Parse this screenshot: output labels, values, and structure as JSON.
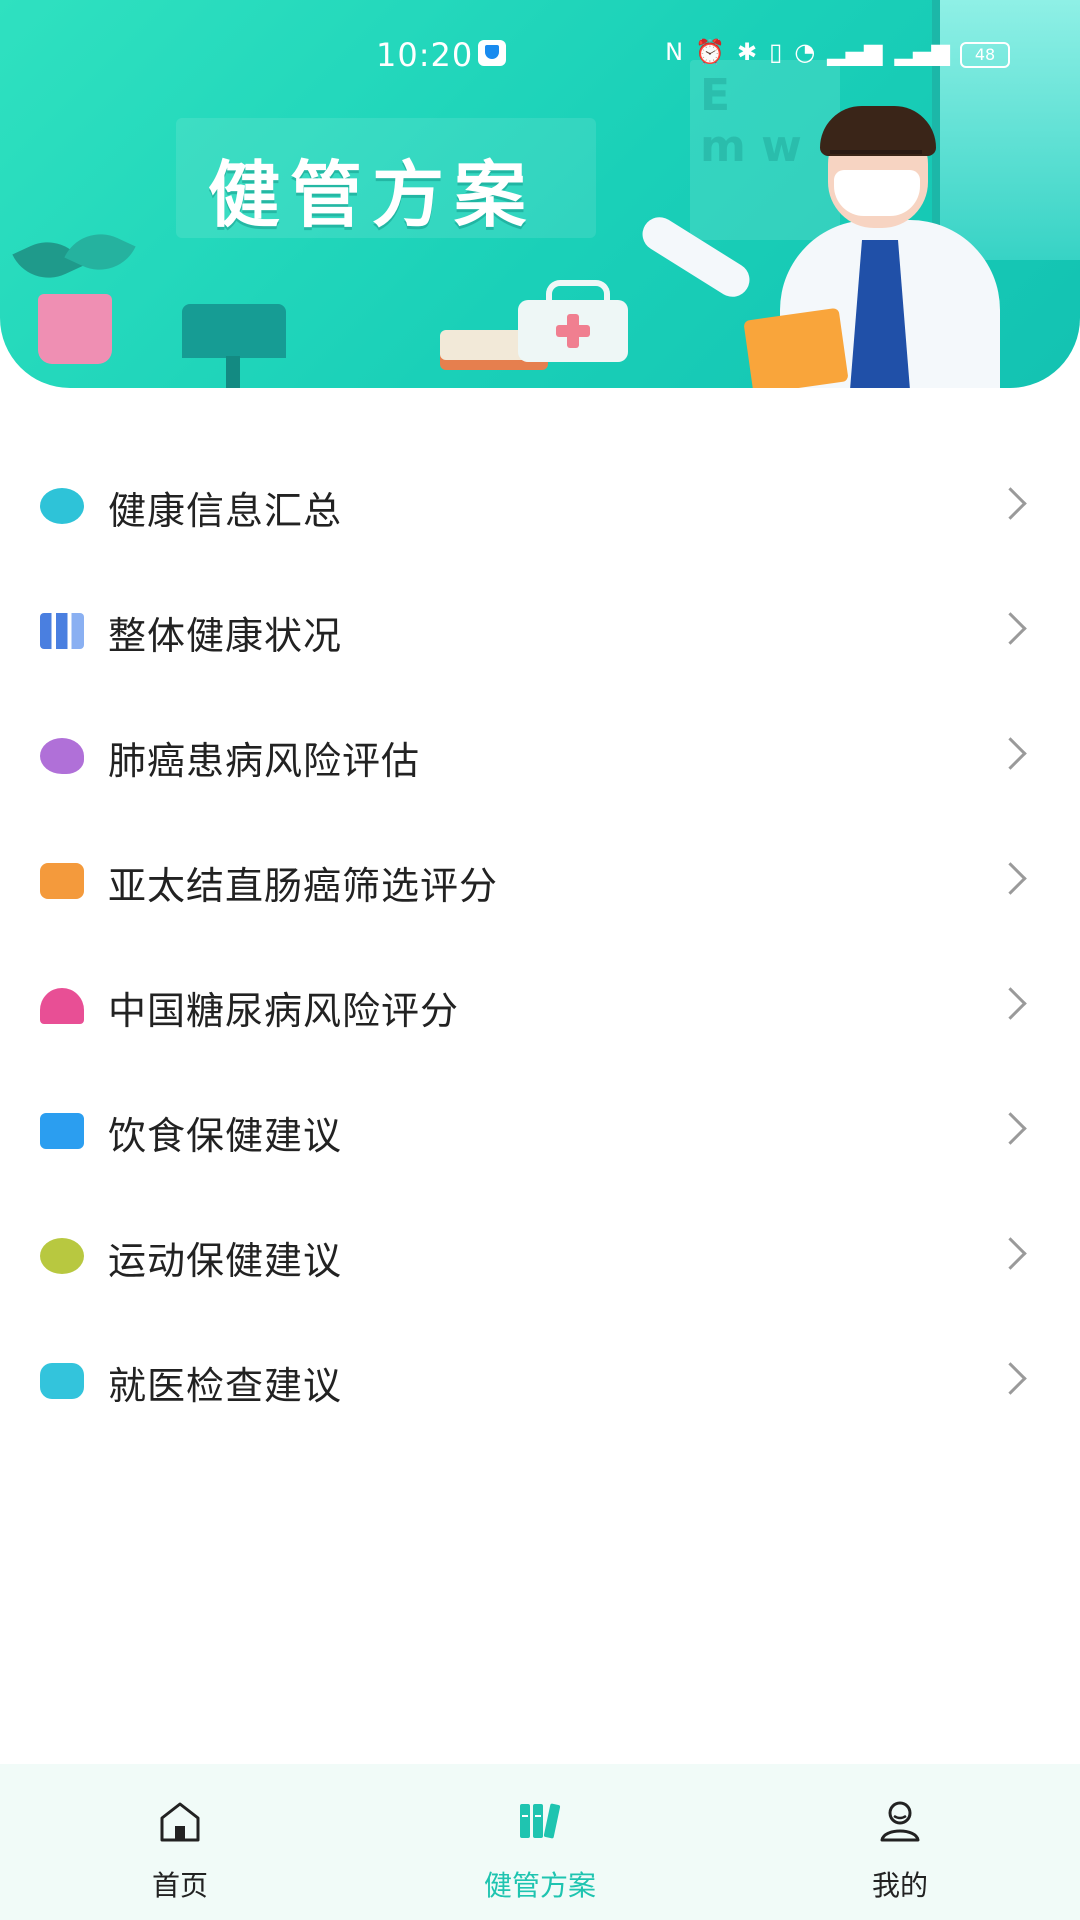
{
  "status_bar": {
    "time": "10:20",
    "battery": "48"
  },
  "header": {
    "title": "健管方案"
  },
  "menu": {
    "items": [
      {
        "label": "健康信息汇总",
        "icon": "shield-plus-icon",
        "color": "#2ec3d8"
      },
      {
        "label": "整体健康状况",
        "icon": "bars-chart-icon",
        "color": "#4a7fe0"
      },
      {
        "label": "肺癌患病风险评估",
        "icon": "flower-list-icon",
        "color": "#b070d8"
      },
      {
        "label": "亚太结直肠癌筛选评分",
        "icon": "toolbox-icon",
        "color": "#f49a3c"
      },
      {
        "label": "中国糖尿病风险评分",
        "icon": "alarm-light-icon",
        "color": "#e84f95"
      },
      {
        "label": "饮食保健建议",
        "icon": "food-bowl-icon",
        "color": "#2b9ef0"
      },
      {
        "label": "运动保健建议",
        "icon": "dumbbell-icon",
        "color": "#b8c840"
      },
      {
        "label": "就医检查建议",
        "icon": "document-lines-icon",
        "color": "#33c4dc"
      }
    ]
  },
  "bottom_nav": {
    "items": [
      {
        "label": "首页",
        "icon": "home-icon",
        "active": false
      },
      {
        "label": "健管方案",
        "icon": "books-icon",
        "active": true
      },
      {
        "label": "我的",
        "icon": "user-icon",
        "active": false
      }
    ],
    "active_color": "#1fc4b0"
  }
}
